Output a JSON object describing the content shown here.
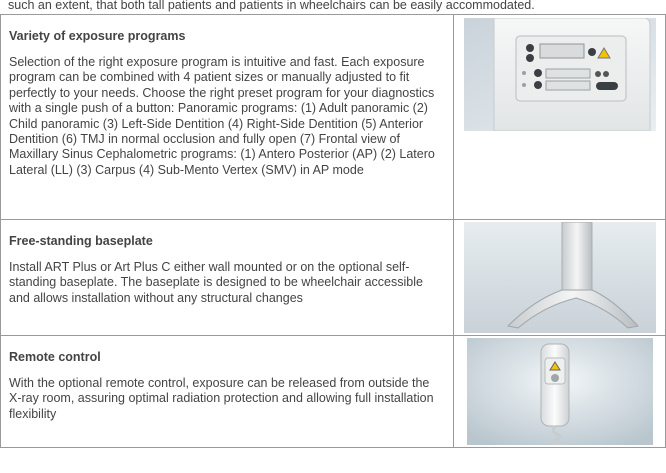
{
  "intro_tail": "such an extent, that both tall patients and patients in wheelchairs can be easily accommodated.",
  "features": [
    {
      "title": "Variety of exposure programs",
      "body": "Selection of the right exposure program is intuitive and fast. Each exposure program can be combined with 4 patient sizes or manually adjusted to fit perfectly to your needs. Choose the right preset program for your diagnostics with a single push of a button: Panoramic programs: (1) Adult panoramic (2) Child panoramic (3) Left-Side Dentition (4) Right-Side Dentition (5) Anterior Dentition (6) TMJ in normal occlusion and fully open (7) Frontal view of Maxillary Sinus Cephalometric programs: (1) Antero Posterior (AP) (2) Latero Lateral (LL) (3) Carpus (4) Sub-Mento Vertex (SMV) in AP mode"
    },
    {
      "title": "Free-standing  baseplate",
      "body": "Install ART Plus or Art Plus C either wall mounted or on the optional self-standing baseplate. The baseplate is designed to be wheelchair accessible and allows installation without any structural changes"
    },
    {
      "title": "Remote control",
      "body": "With the optional remote control, exposure can be released from outside the X-ray room, assuring optimal radiation protection and allowing full installation flexibility"
    }
  ]
}
